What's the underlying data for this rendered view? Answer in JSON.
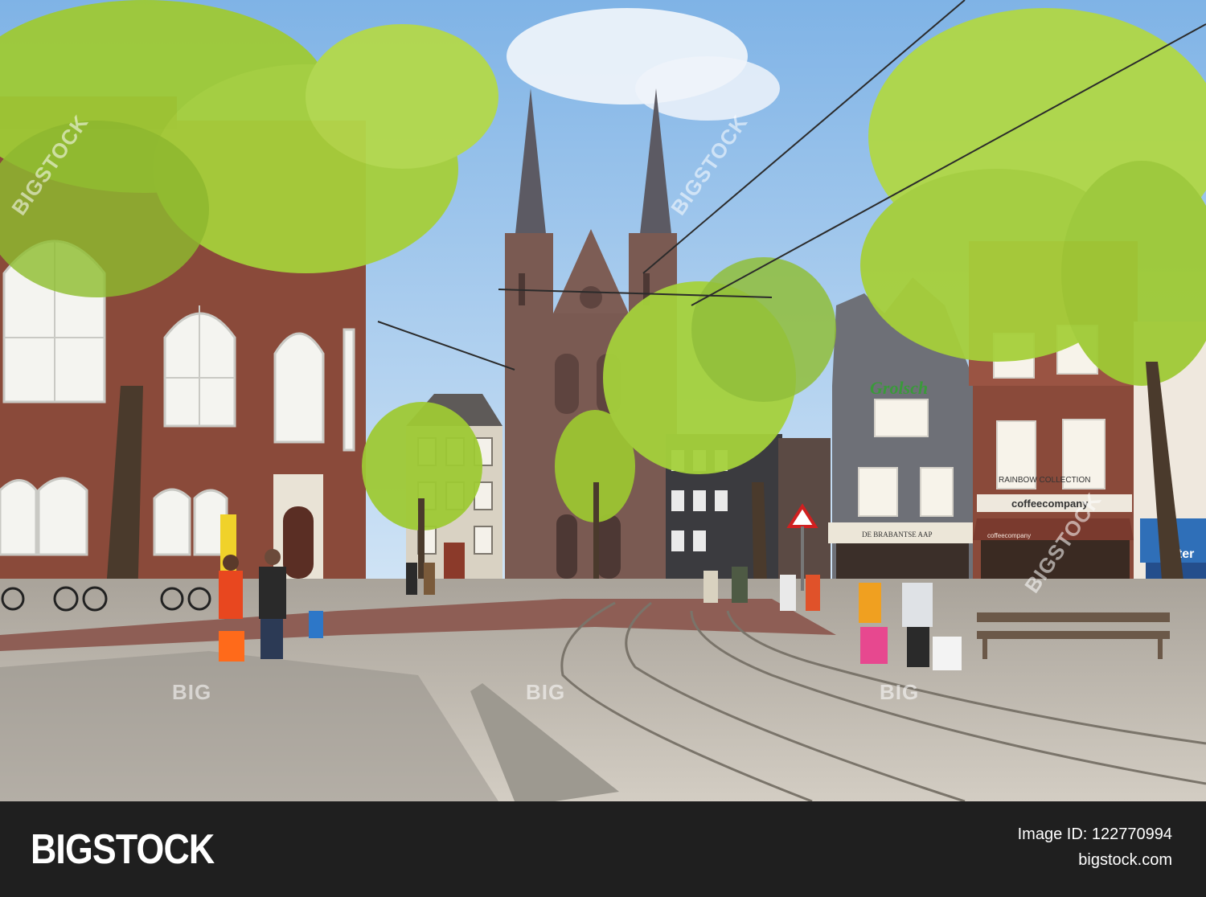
{
  "photo": {
    "subject": "Amsterdam street with tram tracks and a twin-spired Gothic church",
    "signs": {
      "shop_logo": "Grolsch",
      "rainbow": "RAINBOW COLLECTION",
      "coffee": "coffeecompany",
      "brabant": "DE BRABANTSE AAP",
      "coffee_small": "coffeecompany",
      "blue_sign": "kter"
    },
    "colors": {
      "sky": "#a9cdee",
      "church": "#7a5a52",
      "foliage": "#a6cf3a",
      "brick": "#8a4a3a",
      "cobblestone": "#bfb8ad",
      "bike_lane": "#8e5e55"
    }
  },
  "watermarks": {
    "big_1": "BIG",
    "big_2": "BIG",
    "big_3": "BIG",
    "diag_1": "BIGSTOCK",
    "diag_2": "BIGSTOCK",
    "diag_3": "BIGSTOCK"
  },
  "stock_bar": {
    "logo": "BIGSTOCK",
    "image_id": "Image ID: 122770994",
    "site": "bigstock.com"
  }
}
